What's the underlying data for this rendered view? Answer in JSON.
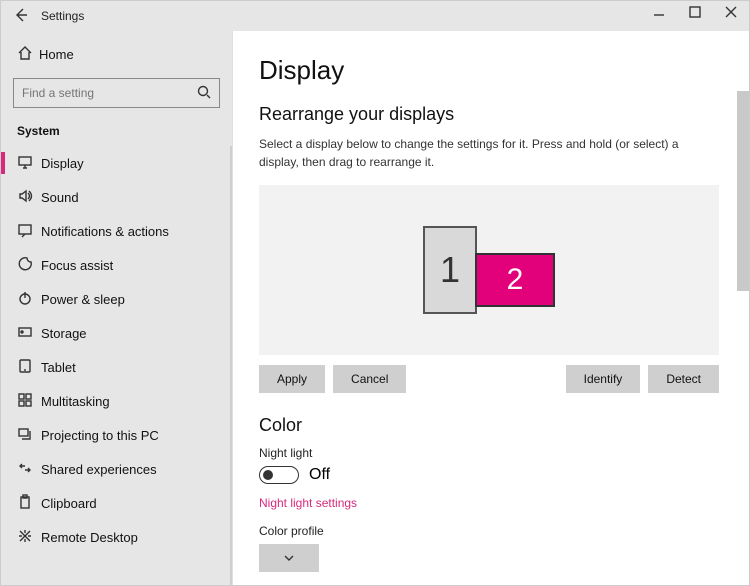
{
  "window": {
    "title": "Settings"
  },
  "sidebar": {
    "home": "Home",
    "search_placeholder": "Find a setting",
    "category": "System",
    "items": [
      {
        "label": "Display"
      },
      {
        "label": "Sound"
      },
      {
        "label": "Notifications & actions"
      },
      {
        "label": "Focus assist"
      },
      {
        "label": "Power & sleep"
      },
      {
        "label": "Storage"
      },
      {
        "label": "Tablet"
      },
      {
        "label": "Multitasking"
      },
      {
        "label": "Projecting to this PC"
      },
      {
        "label": "Shared experiences"
      },
      {
        "label": "Clipboard"
      },
      {
        "label": "Remote Desktop"
      }
    ]
  },
  "main": {
    "heading": "Display",
    "rearrange_heading": "Rearrange your displays",
    "rearrange_desc": "Select a display below to change the settings for it. Press and hold (or select) a display, then drag to rearrange it.",
    "monitor1": "1",
    "monitor2": "2",
    "apply": "Apply",
    "cancel": "Cancel",
    "identify": "Identify",
    "detect": "Detect",
    "color_heading": "Color",
    "night_light_label": "Night light",
    "night_light_state": "Off",
    "night_light_link": "Night light settings",
    "color_profile_label": "Color profile"
  }
}
